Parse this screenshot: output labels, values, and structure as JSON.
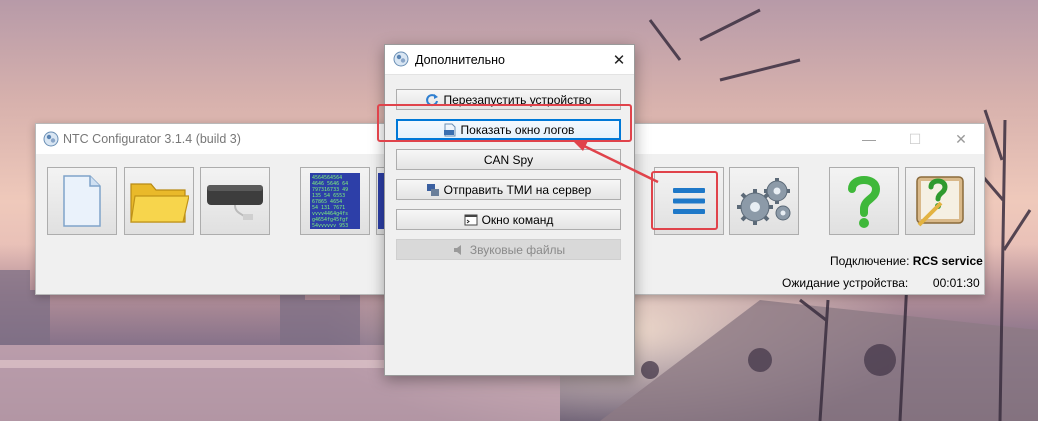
{
  "main_window": {
    "title": "NTC Configurator 3.1.4 (build 3)",
    "controls": {
      "minimize": "—",
      "maximize": "☐",
      "close": "✕"
    },
    "toolbar": [
      {
        "name": "new-file",
        "icon": "document-icon"
      },
      {
        "name": "open-folder",
        "icon": "folder-icon"
      },
      {
        "name": "device",
        "icon": "device-icon"
      },
      {
        "name": "data-view",
        "icon": "hex-data-icon",
        "hex_lines": [
          "4564564564",
          "4646 5646 64",
          "797316733 49",
          "135 54 6553",
          "67865 4654",
          "54 131 7671",
          "vvvv4464g4fs",
          "g4654fg45fgf",
          "54vvvvvv 953"
        ]
      },
      {
        "name": "menu",
        "icon": "hamburger-menu-icon"
      },
      {
        "name": "settings",
        "icon": "gears-icon"
      },
      {
        "name": "help",
        "icon": "question-icon"
      },
      {
        "name": "notes",
        "icon": "notes-icon"
      }
    ],
    "status": {
      "connection_label": "Подключение:",
      "connection_value": "RCS service",
      "waiting_label": "Ожидание устройства:",
      "waiting_value": "00:01:30"
    }
  },
  "dialog": {
    "title": "Дополнительно",
    "close": "✕",
    "buttons": [
      {
        "label": "Перезапустить устройство",
        "icon": "restart-icon",
        "state": "normal"
      },
      {
        "label": "Показать окно логов",
        "icon": "log-icon",
        "state": "focused"
      },
      {
        "label": "CAN Spy",
        "icon": "",
        "state": "normal"
      },
      {
        "label": "Отправить ТМИ на сервер",
        "icon": "upload-icon",
        "state": "normal"
      },
      {
        "label": "Окно команд",
        "icon": "cmd-icon",
        "state": "normal"
      },
      {
        "label": "Звуковые файлы",
        "icon": "sound-icon",
        "state": "disabled"
      }
    ]
  },
  "annotations": {
    "highlight_color": "#e0434b"
  },
  "colors": {
    "accent": "#0078d7",
    "menu_icon": "#1e78c8"
  }
}
